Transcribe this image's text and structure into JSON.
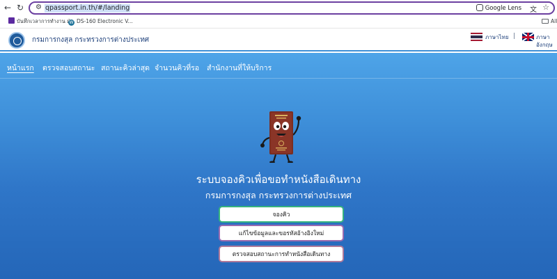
{
  "browser": {
    "url": "qpassport.in.th/#/landing",
    "google_lens_label": "Google Lens",
    "bookmarks": [
      {
        "label": "บันทึกเวลาการทำงาน ฝ่..."
      },
      {
        "label": "DS-160 Electronic V..."
      },
      {
        "label": "All"
      }
    ]
  },
  "site": {
    "title": "กรมการกงสุล กระทรวงการต่างประเทศ",
    "lang_thai": "ภาษาไทย",
    "lang_english": "ภาษาอังกฤษ"
  },
  "nav": {
    "items": [
      {
        "label": "หน้าแรก"
      },
      {
        "label": "ตรวจสอบสถานะ"
      },
      {
        "label": "สถานะคิวล่าสุด"
      },
      {
        "label": "จำนวนคิวที่รอ"
      },
      {
        "label": "สำนักงานที่ให้บริการ"
      }
    ]
  },
  "hero": {
    "headline": "ระบบจองคิวเพื่อขอทำหนังสือเดินทาง",
    "subheadline": "กรมการกงสุล กระทรวงการต่างประเทศ",
    "buttons": [
      {
        "label": "จองคิว"
      },
      {
        "label": "แก้ไขข้อมูลและขอรหัสอ้างอิงใหม่"
      },
      {
        "label": "ตรวจสอบสถานะการทำหนังสือเดินทาง"
      }
    ]
  },
  "colors": {
    "brand_blue": "#1d3f7a",
    "accent_border": "#3d8fd6",
    "primary_button_border": "#36b37e"
  }
}
